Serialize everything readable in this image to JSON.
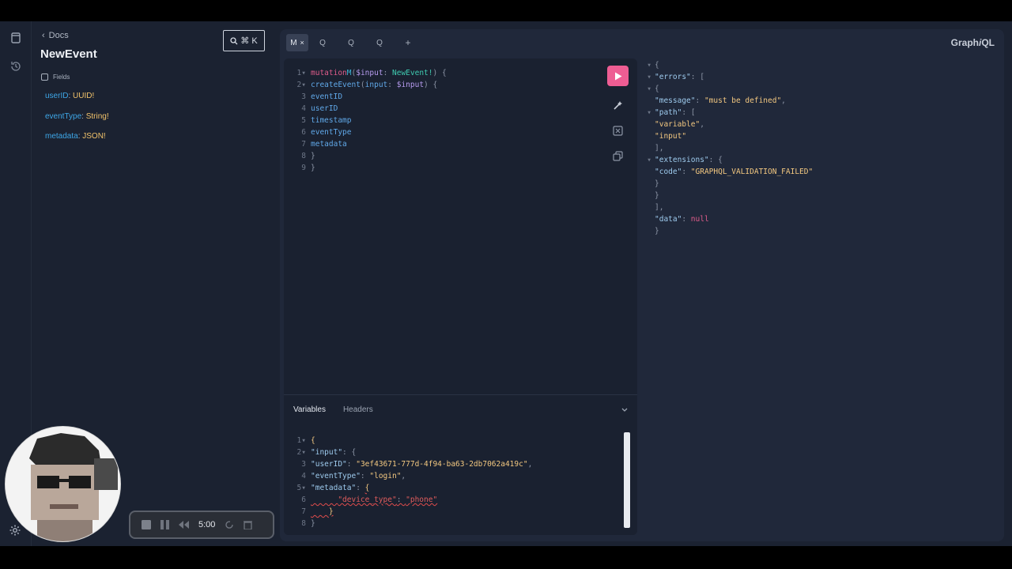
{
  "sidebar": {
    "icons": [
      "docs-icon",
      "history-icon",
      "settings-icon"
    ]
  },
  "docs": {
    "back_label": "Docs",
    "title": "NewEvent",
    "search_label": "⌘ K",
    "fields_label": "Fields",
    "fields": [
      {
        "name": "userID",
        "type": "UUID!"
      },
      {
        "name": "eventType",
        "type": "String!"
      },
      {
        "name": "metadata",
        "type": "JSON!"
      }
    ]
  },
  "tabs": [
    {
      "label": "M",
      "active": true
    },
    {
      "label": "Q",
      "active": false
    },
    {
      "label": "Q",
      "active": false
    },
    {
      "label": "Q",
      "active": false
    }
  ],
  "add_tab_label": "+",
  "brand": {
    "prefix": "Graph",
    "accent": "i",
    "suffix": "QL"
  },
  "query": {
    "line_numbers": [
      "1",
      "2",
      "3",
      "4",
      "5",
      "6",
      "7",
      "8",
      "9"
    ],
    "keyword": "mutation",
    "operation_name": "M",
    "variable": "$input",
    "variable_type": "NewEvent!",
    "field_call": "createEvent",
    "argument": "input",
    "fields": [
      "eventID",
      "userID",
      "timestamp",
      "eventType",
      "metadata"
    ]
  },
  "variables_panel": {
    "tabs": [
      "Variables",
      "Headers"
    ],
    "line_numbers": [
      "1",
      "2",
      "3",
      "4",
      "5",
      "6",
      "7",
      "8"
    ],
    "input_key": "\"input\"",
    "user_id_key": "\"userID\"",
    "user_id_value": "\"3ef43671-777d-4f94-ba63-2db7062a419c\"",
    "event_type_key": "\"eventType\"",
    "event_type_value": "\"login\"",
    "metadata_key": "\"metadata\"",
    "device_key": "\"device_type\"",
    "device_value": "\"phone\""
  },
  "response": {
    "errors_key": "\"errors\"",
    "message_key": "\"message\"",
    "message_value": "\"must be defined\"",
    "path_key": "\"path\"",
    "path_values": [
      "\"variable\"",
      "\"input\""
    ],
    "extensions_key": "\"extensions\"",
    "code_key": "\"code\"",
    "code_value": "\"GRAPHQL_VALIDATION_FAILED\"",
    "data_key": "\"data\"",
    "data_value": "null"
  },
  "recorder": {
    "time": "5:00"
  },
  "colors": {
    "accent_pink": "#ee5d93",
    "field_blue": "#3ea7e8",
    "type_yellow": "#f2c36b"
  }
}
